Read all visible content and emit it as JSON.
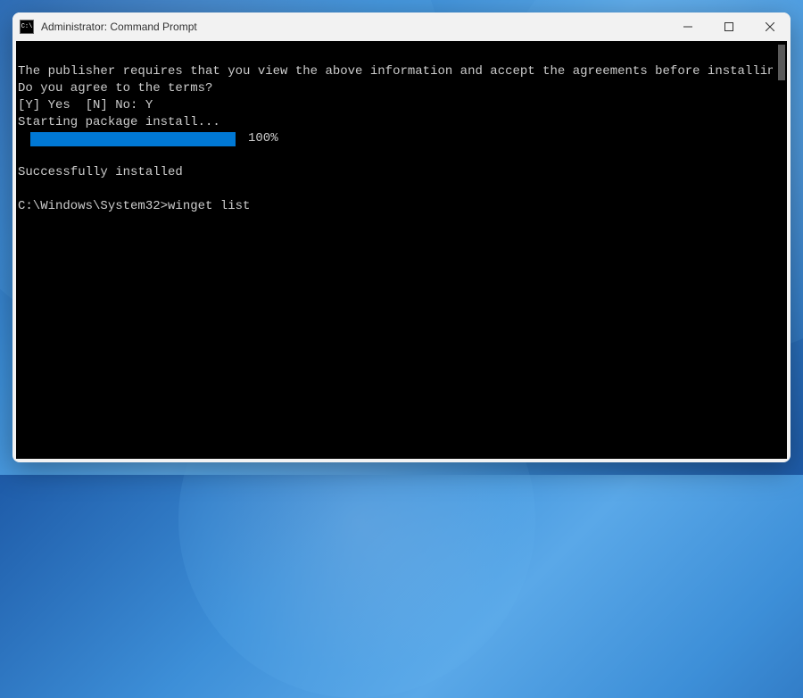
{
  "window": {
    "title": "Administrator: Command Prompt",
    "icon_label": "C:\\"
  },
  "terminal": {
    "line1": "The publisher requires that you view the above information and accept the agreements before installing.",
    "line2": "Do you agree to the terms?",
    "line3": "[Y] Yes  [N] No: Y",
    "line4": "Starting package install...",
    "progress_pct": "100%",
    "line5": "Successfully installed",
    "prompt_path": "C:\\Windows\\System32>",
    "command": "winget list"
  },
  "controls": {
    "minimize": "─",
    "maximize": "▢",
    "close": "✕"
  }
}
